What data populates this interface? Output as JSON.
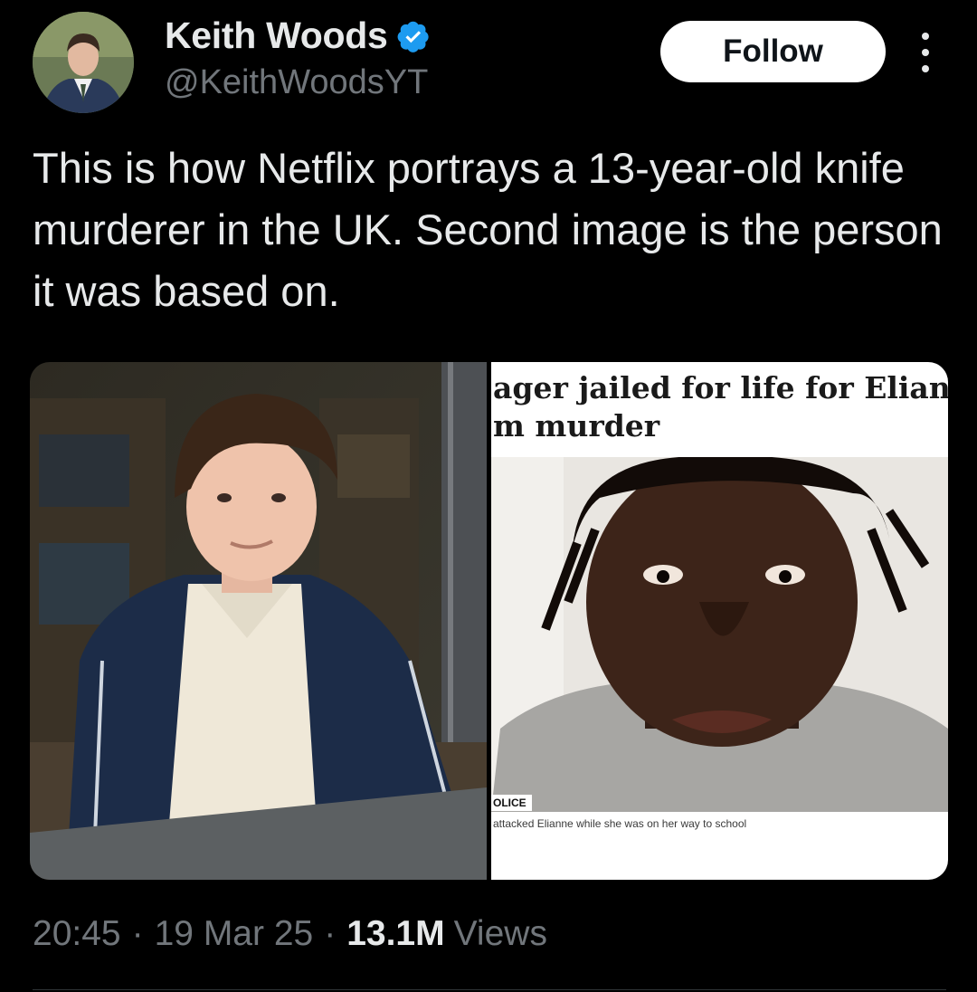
{
  "author": {
    "display_name": "Keith Woods",
    "handle": "@KeithWoodsYT",
    "verified": true,
    "verified_color": "#1d9bf0"
  },
  "actions": {
    "follow_label": "Follow",
    "more_icon": "more-vertical-icon"
  },
  "tweet": {
    "text": "This is how Netflix portrays a 13-year-old knife murderer in the UK. Second image is the person it was based on."
  },
  "media": {
    "right_headline_line1": "ager jailed for life for Elian",
    "right_headline_line2": "m murder",
    "right_credit": "OLICE",
    "right_caption": "attacked Elianne while she was on her way to school"
  },
  "meta": {
    "time": "20:45",
    "date": "19 Mar 25",
    "separator": "·",
    "views_count": "13.1M",
    "views_label": "Views"
  },
  "colors": {
    "background": "#000000",
    "text_primary": "#e7e9ea",
    "text_secondary": "#71767b",
    "follow_bg": "#ffffff",
    "follow_text": "#0f1419",
    "divider": "#2f3336"
  }
}
